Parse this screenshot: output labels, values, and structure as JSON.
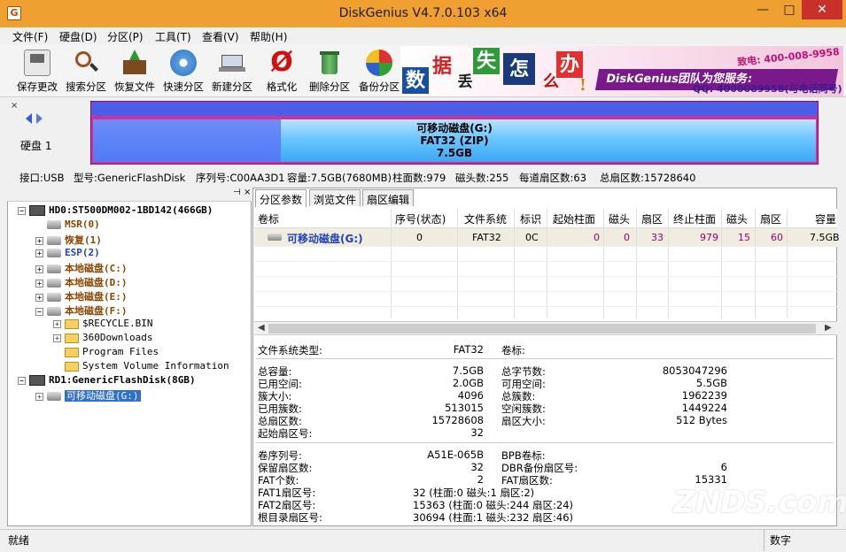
{
  "window": {
    "title": "DiskGenius V4.7.0.103 x64",
    "minimize": "—",
    "maximize": "□",
    "close": "✕"
  },
  "menu": [
    "文件(F)",
    "硬盘(D)",
    "分区(P)",
    "工具(T)",
    "查看(V)",
    "帮助(H)"
  ],
  "toolbar": [
    {
      "label": "保存更改",
      "icon": "save-icon"
    },
    {
      "label": "搜索分区",
      "icon": "search-icon"
    },
    {
      "label": "恢复文件",
      "icon": "recover-icon"
    },
    {
      "label": "快速分区",
      "icon": "quick-partition-icon"
    },
    {
      "label": "新建分区",
      "icon": "new-partition-icon"
    },
    {
      "label": "格式化",
      "icon": "format-icon"
    },
    {
      "label": "删除分区",
      "icon": "delete-icon"
    },
    {
      "label": "备份分区",
      "icon": "backup-icon"
    }
  ],
  "banner": {
    "chars": [
      "数",
      "据",
      "丢",
      "失",
      "怎",
      "么",
      "办",
      "!"
    ],
    "brand": "DiskGenius团队为您服务:",
    "phone": "致电: 400-008-9958",
    "qq": "QQ: 4000089958(与电话同号)"
  },
  "disk": {
    "label": "硬盘 1",
    "partition_name": "可移动磁盘(G:)",
    "partition_fs": "FAT32 (ZIP)",
    "partition_size": "7.5GB",
    "highlight_fraction": 0.26
  },
  "diskinfo": {
    "iface": "接口:USB",
    "model": "型号:GenericFlashDisk",
    "serial": "序列号:C00AA3D1",
    "capacity": "容量:7.5GB(7680MB)",
    "cyl": "柱面数:979",
    "heads": "磁头数:255",
    "spt": "每道扇区数:63",
    "sectors": "总扇区数:15728640"
  },
  "tree": [
    {
      "text": "HD0:ST500DM002-1BD142(466GB)",
      "style": "black",
      "expand": "−",
      "icon": "hdd"
    },
    {
      "text": "MSR(0)",
      "style": "brown",
      "expand": "",
      "icon": "disk"
    },
    {
      "text": "恢复(1)",
      "style": "brown",
      "expand": "+",
      "icon": "disk"
    },
    {
      "text": "ESP(2)",
      "style": "blue",
      "expand": "+",
      "icon": "disk"
    },
    {
      "text": "本地磁盘(C:)",
      "style": "brown",
      "expand": "+",
      "icon": "disk"
    },
    {
      "text": "本地磁盘(D:)",
      "style": "brown",
      "expand": "+",
      "icon": "disk"
    },
    {
      "text": "本地磁盘(E:)",
      "style": "brown",
      "expand": "+",
      "icon": "disk"
    },
    {
      "text": "本地磁盘(F:)",
      "style": "brown",
      "expand": "−",
      "icon": "disk"
    },
    {
      "text": "$RECYCLE.BIN",
      "style": "black",
      "expand": "+",
      "icon": "folder"
    },
    {
      "text": "360Downloads",
      "style": "black",
      "expand": "+",
      "icon": "folder"
    },
    {
      "text": "Program Files",
      "style": "black",
      "expand": "",
      "icon": "folder"
    },
    {
      "text": "System Volume Information",
      "style": "black",
      "expand": "",
      "icon": "folder"
    },
    {
      "text": "RD1:GenericFlashDisk(8GB)",
      "style": "black",
      "expand": "−",
      "icon": "hdd"
    },
    {
      "text": "可移动磁盘(G:)",
      "style": "sel",
      "expand": "+",
      "icon": "disk"
    }
  ],
  "tabs": [
    "分区参数",
    "浏览文件",
    "扇区编辑"
  ],
  "table": {
    "headers": [
      "卷标",
      "序号(状态)",
      "文件系统",
      "标识",
      "起始柱面",
      "磁头",
      "扇区",
      "终止柱面",
      "磁头",
      "扇区",
      "容量"
    ],
    "row": [
      "可移动磁盘(G:)",
      "0",
      "FAT32",
      "0C",
      "0",
      "0",
      "33",
      "979",
      "15",
      "60",
      "7.5GB"
    ]
  },
  "fsinfo": {
    "fs_type_label": "文件系统类型:",
    "fs_type": "FAT32",
    "vol_label": "卷标:",
    "left": [
      [
        "总容量:",
        "7.5GB"
      ],
      [
        "已用空间:",
        "2.0GB"
      ],
      [
        "簇大小:",
        "4096"
      ],
      [
        "已用簇数:",
        "513015"
      ],
      [
        "总扇区数:",
        "15728608"
      ],
      [
        "起始扇区号:",
        "32"
      ]
    ],
    "right": [
      [
        "总字节数:",
        "8053047296"
      ],
      [
        "可用空间:",
        "5.5GB"
      ],
      [
        "总簇数:",
        "1962239"
      ],
      [
        "空闲簇数:",
        "1449224"
      ],
      [
        "扇区大小:",
        "512 Bytes"
      ]
    ],
    "left2": [
      [
        "卷序列号:",
        "A51E-065B"
      ],
      [
        "保留扇区数:",
        "32"
      ],
      [
        "FAT个数:",
        "2"
      ],
      [
        "FAT1扇区号:",
        "32 (柱面:0 磁头:1 扇区:2)"
      ],
      [
        "FAT2扇区号:",
        "15363 (柱面:0 磁头:244 扇区:24)"
      ],
      [
        "根目录扇区号:",
        "30694 (柱面:1 磁头:232 扇区:46)"
      ]
    ],
    "right2": [
      [
        "BPB卷标:",
        ""
      ],
      [
        "DBR备份扇区号:",
        "6"
      ],
      [
        "FAT扇区数:",
        "15331"
      ]
    ]
  },
  "status": {
    "left": "就绪",
    "right": "数字"
  },
  "watermark": "ZNDS.com"
}
